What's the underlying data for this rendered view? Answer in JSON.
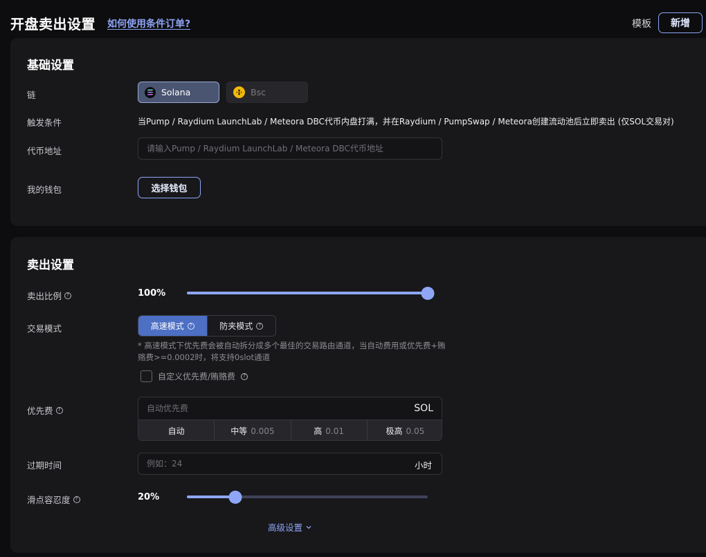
{
  "header": {
    "title": "开盘卖出设置",
    "help_link": "如何使用条件订单?",
    "template_link": "模板",
    "add_button": "新增"
  },
  "basic": {
    "title": "基础设置",
    "chain_label": "链",
    "chains": [
      {
        "name": "Solana",
        "selected": true,
        "icon": "solana-icon"
      },
      {
        "name": "Bsc",
        "selected": false,
        "icon": "bnb-icon"
      }
    ],
    "trigger_label": "触发条件",
    "trigger_text": "当Pump / Raydium LaunchLab / Meteora DBC代币内盘打满，并在Raydium / PumpSwap / Meteora创建流动池后立即卖出 (仅SOL交易对)",
    "token_label": "代币地址",
    "token_placeholder": "请输入Pump / Raydium LaunchLab / Meteora DBC代币地址",
    "token_value": "",
    "wallet_label": "我的钱包",
    "wallet_button": "选择钱包"
  },
  "sell": {
    "title": "卖出设置",
    "ratio_label": "卖出比例",
    "ratio_text": "100%",
    "ratio_value": 100,
    "mode_label": "交易模式",
    "modes": [
      {
        "label": "高速模式",
        "active": true
      },
      {
        "label": "防夹模式",
        "active": false
      }
    ],
    "mode_note": "* 高速模式下优先费会被自动拆分成多个最佳的交易路由通道，当自动费用或优先费+贿赂费>=0.0002时，将支持0slot通道",
    "custom_fee_label": "自定义优先费/贿赂费",
    "custom_fee_checked": false,
    "priority_label": "优先费",
    "priority_placeholder": "自动优先费",
    "priority_unit": "SOL",
    "priority_options": [
      {
        "label": "自动",
        "value": ""
      },
      {
        "label": "中等",
        "value": "0.005"
      },
      {
        "label": "高",
        "value": "0.01"
      },
      {
        "label": "极高",
        "value": "0.05"
      }
    ],
    "expire_label": "过期时间",
    "expire_placeholder": "例如：24",
    "expire_unit": "小时",
    "slippage_label": "滑点容忍度",
    "slippage_text": "20%",
    "slippage_value": 20,
    "advanced_label": "高级设置"
  },
  "colors": {
    "accent": "#8ea6f5",
    "active_mode": "#4d6fc4",
    "card_bg": "#18181b",
    "page_bg": "#0d0d0f"
  }
}
